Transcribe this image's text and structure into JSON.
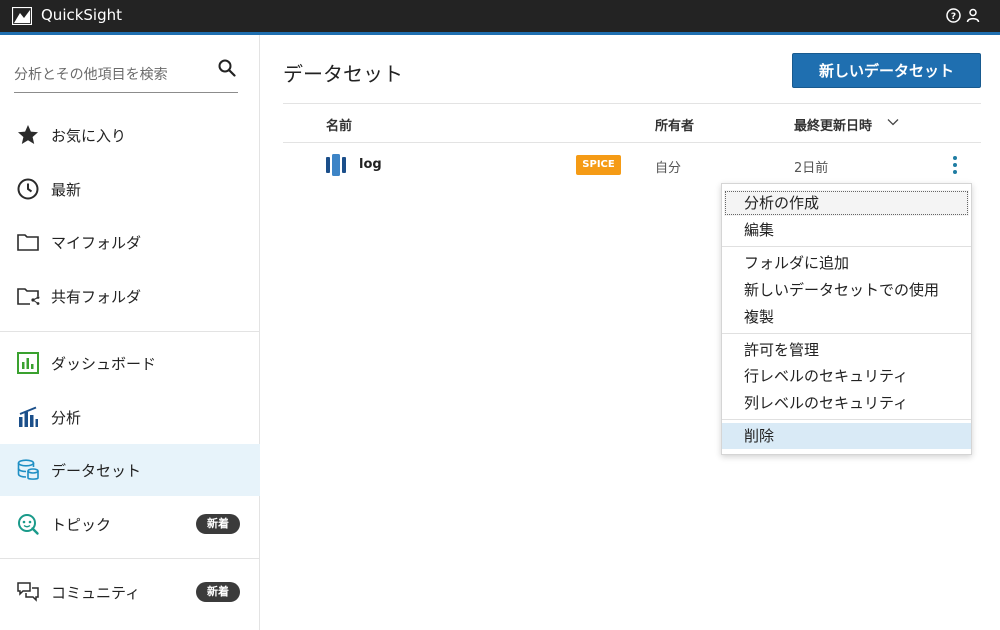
{
  "app": {
    "title": "QuickSight"
  },
  "sidebar": {
    "search_placeholder": "分析とその他項目を検索",
    "items": [
      {
        "label": "お気に入り",
        "icon": "star-icon"
      },
      {
        "label": "最新",
        "icon": "clock-icon"
      },
      {
        "label": "マイフォルダ",
        "icon": "folder-icon"
      },
      {
        "label": "共有フォルダ",
        "icon": "shared-folder-icon"
      },
      {
        "label": "ダッシュボード",
        "icon": "dashboard-icon"
      },
      {
        "label": "分析",
        "icon": "analysis-icon"
      },
      {
        "label": "データセット",
        "icon": "dataset-icon",
        "active": true
      },
      {
        "label": "トピック",
        "icon": "topic-icon",
        "badge": "新着"
      },
      {
        "label": "コミュニティ",
        "icon": "community-icon",
        "badge": "新着"
      }
    ]
  },
  "main": {
    "title": "データセット",
    "new_button": "新しいデータセット",
    "columns": {
      "name": "名前",
      "owner": "所有者",
      "updated": "最終更新日時"
    },
    "rows": [
      {
        "name": "log",
        "badge": "SPICE",
        "owner": "自分",
        "updated": "2日前"
      }
    ]
  },
  "context_menu": {
    "items": [
      "分析の作成",
      "編集",
      "フォルダに追加",
      "新しいデータセットでの使用",
      "複製",
      "許可を管理",
      "行レベルのセキュリティ",
      "列レベルのセキュリティ",
      "削除"
    ]
  },
  "colors": {
    "topbar": "#232323",
    "accent": "#1f6fb0",
    "active_nav": "#e7f3fa",
    "spice_badge": "#f59b15",
    "menu_highlight": "#d9eaf6"
  }
}
